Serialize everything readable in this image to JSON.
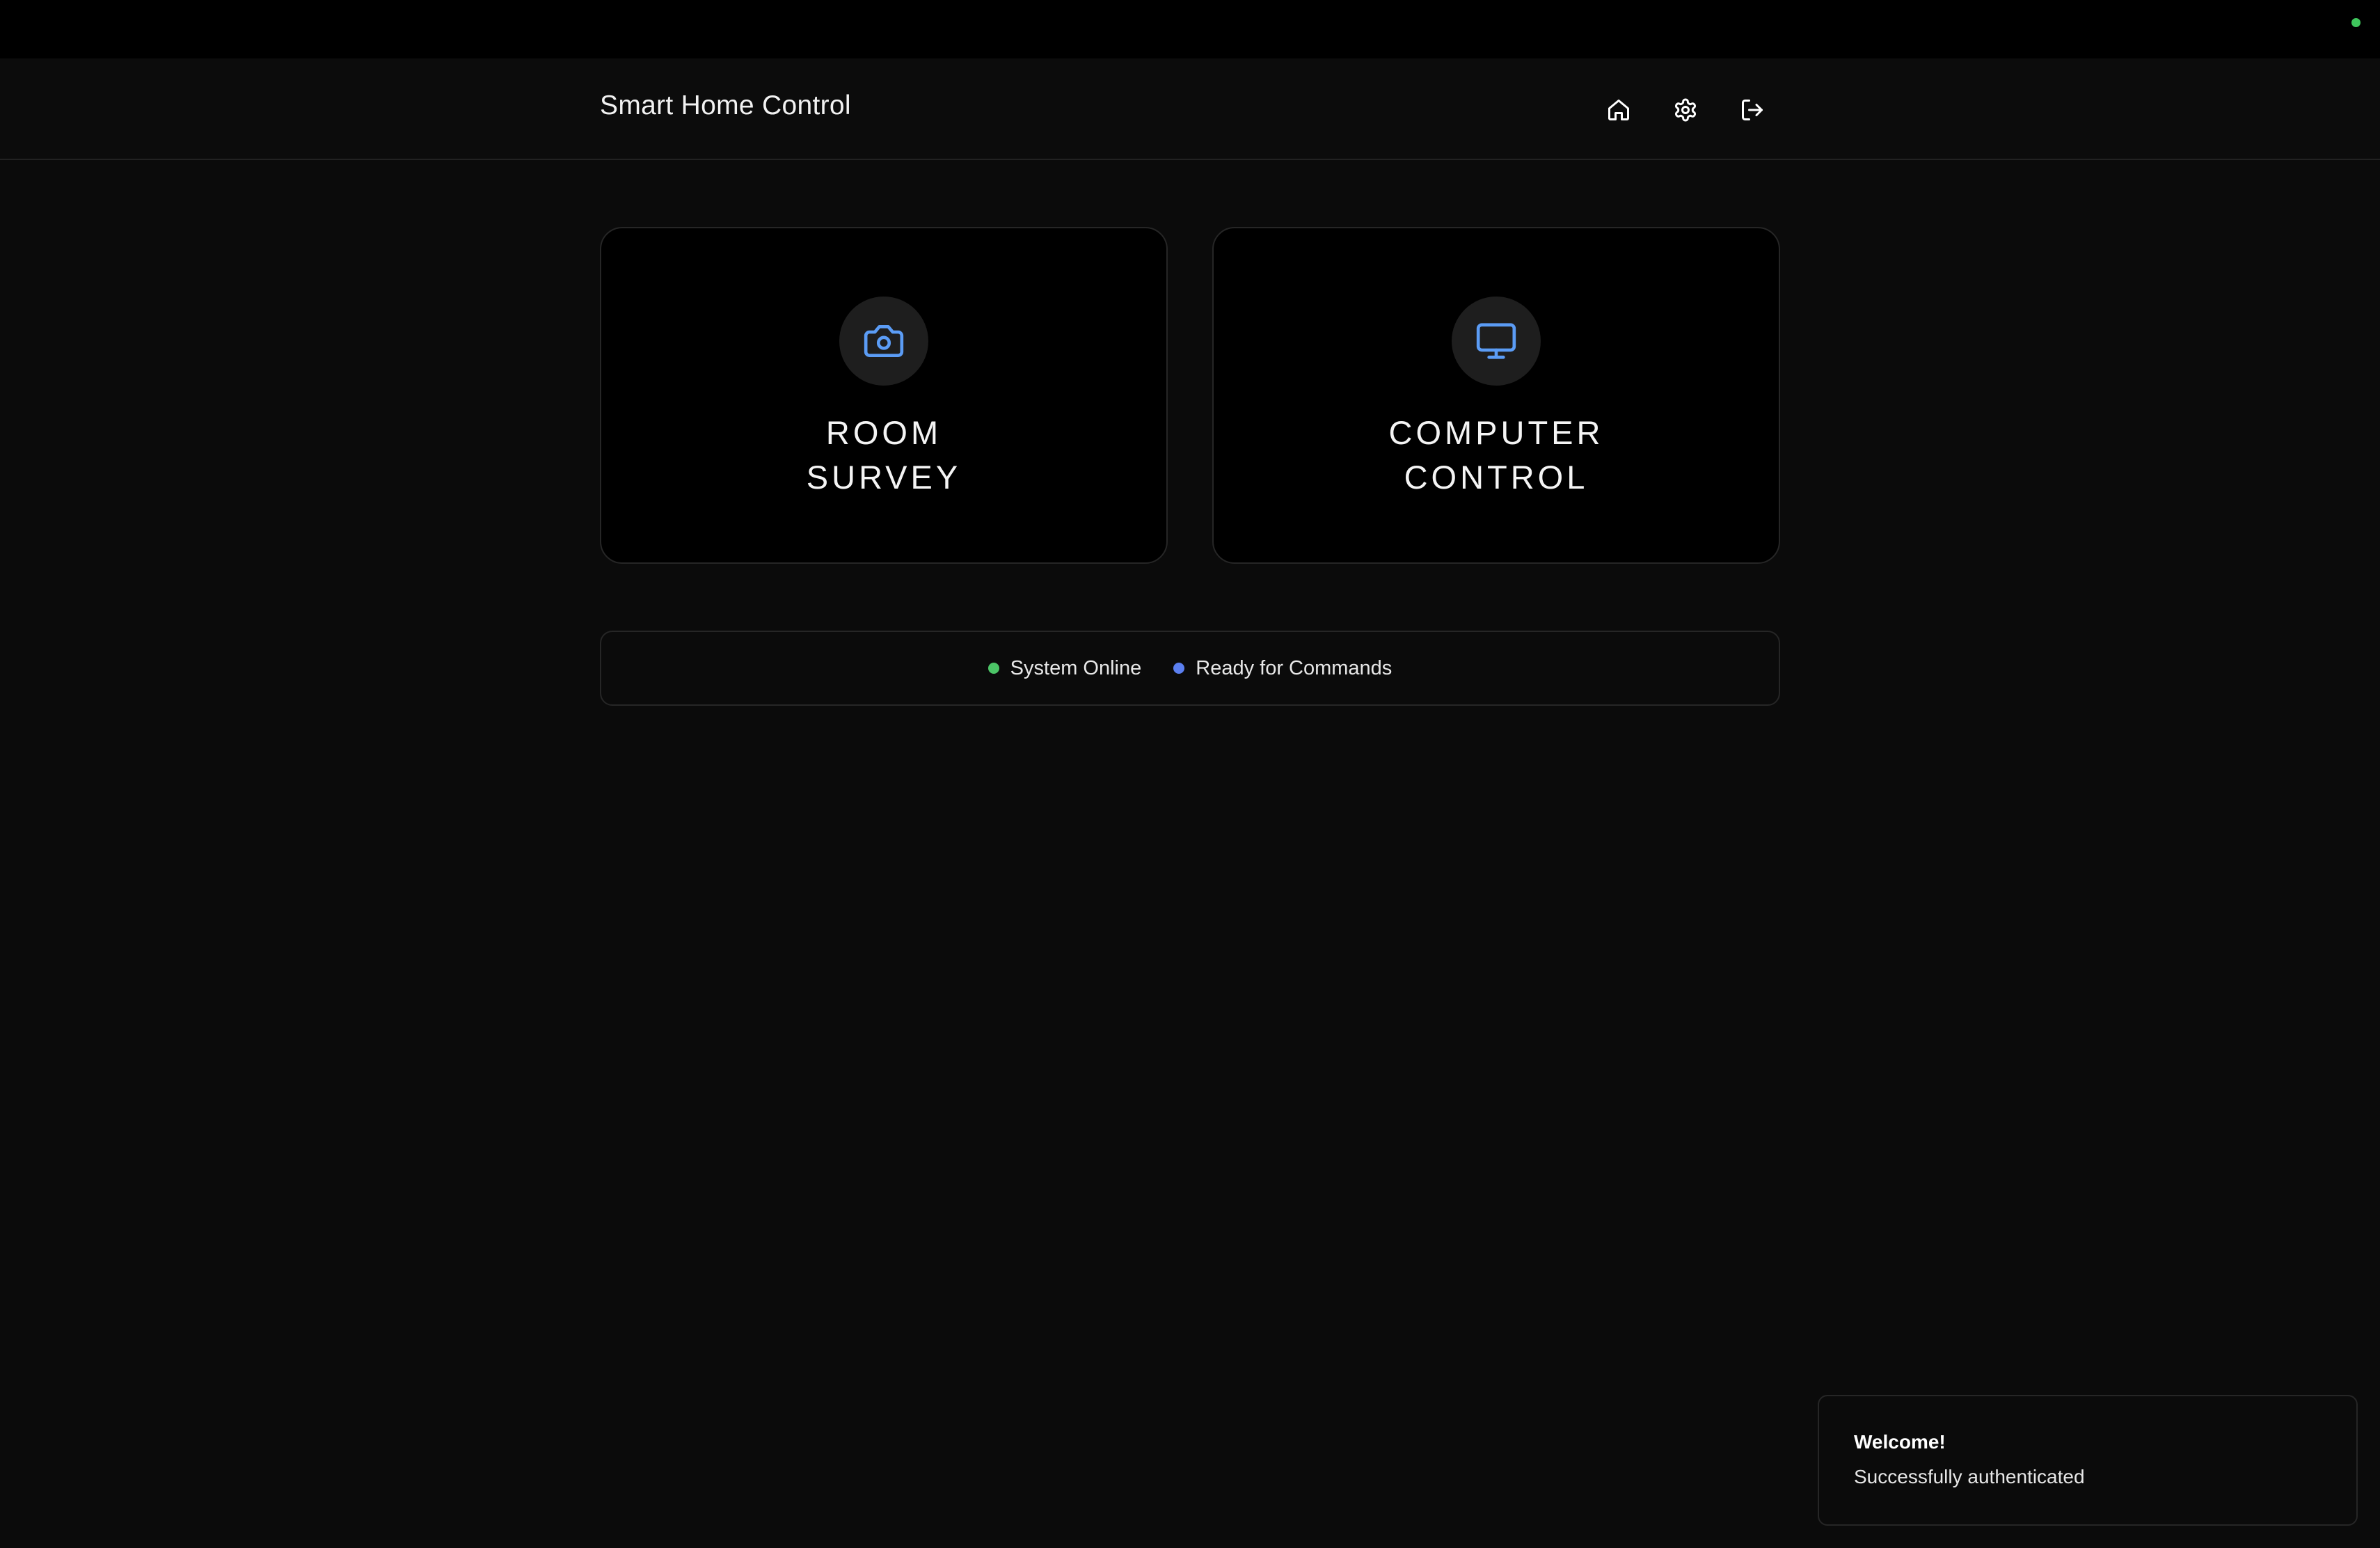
{
  "header": {
    "title": "Smart Home Control",
    "icons": [
      "home-icon",
      "settings-icon",
      "logout-icon"
    ]
  },
  "cards": [
    {
      "icon": "camera-icon",
      "line1": "ROOM",
      "line2": "SURVEY"
    },
    {
      "icon": "monitor-icon",
      "line1": "COMPUTER",
      "line2": "CONTROL"
    }
  ],
  "status": [
    {
      "label": "System Online",
      "color": "#4cc567"
    },
    {
      "label": "Ready for Commands",
      "color": "#5b7ff0"
    }
  ],
  "toast": {
    "title": "Welcome!",
    "message": "Successfully authenticated"
  },
  "colors": {
    "accent": "#5b9cf5",
    "online_indicator": "#3fc65c"
  }
}
